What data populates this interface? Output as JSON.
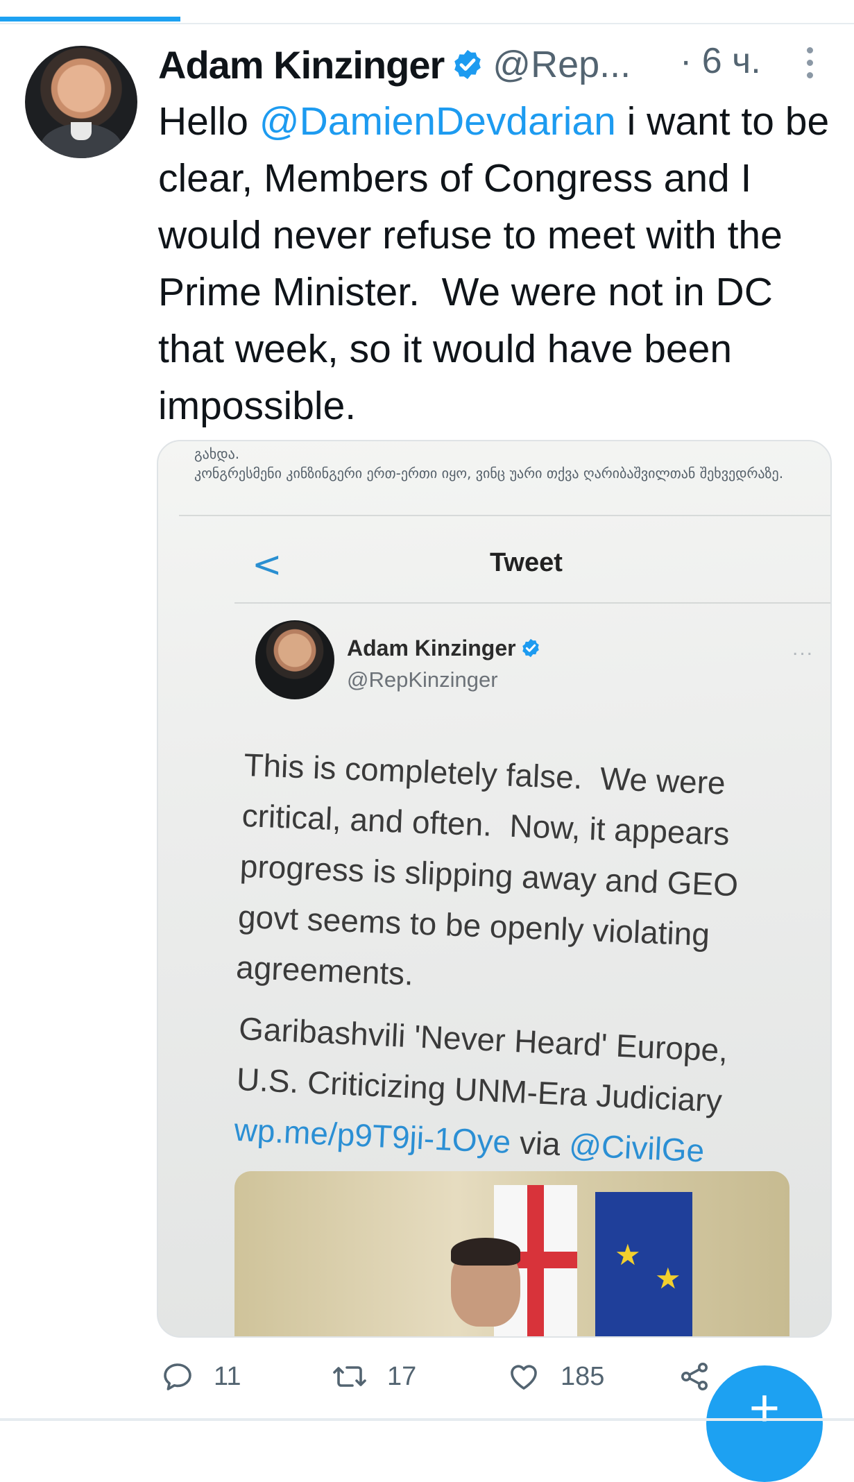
{
  "tweet": {
    "author_name": "Adam Kinzinger",
    "handle": "@Rep...",
    "time": "· 6 ч.",
    "text_before": "Hello ",
    "mention": "@DamienDevdarian",
    "text_after": " i want to be clear, Members of Congress and I would never refuse to meet with the Prime Minister.  We were not in DC that week, so it would have been impossible."
  },
  "media": {
    "georgian_text": "გახდა.\nკონგრესმენი კინზინგერი ერთ-ერთი იყო, ვინც უარი თქვა ღარიბაშვილთან შეხვედრაზე.",
    "inner_back": "<",
    "inner_title": "Tweet",
    "inner_author": "Adam Kinzinger",
    "inner_handle": "@RepKinzinger",
    "inner_more": "...",
    "inner_text": "This is completely false.  We were critical, and often.  Now, it appears progress is slipping away and GEO govt seems to be openly violating agreements.",
    "inner_headline": "Garibashvili 'Never Heard' Europe, U.S. Criticizing UNM-Era Judiciary",
    "inner_link": "wp.me/p9T9ji-1Oye",
    "inner_via": " via ",
    "inner_via_handle": "@CivilGe"
  },
  "actions": {
    "reply_count": "11",
    "retweet_count": "17",
    "like_count": "185"
  },
  "fab": {
    "label": "+"
  },
  "colors": {
    "accent": "#1da1f2",
    "link": "#1d9bf0",
    "secondary_text": "#536471"
  },
  "icons": [
    "verified-badge-icon",
    "more-vertical-icon",
    "back-chevron-icon",
    "reply-icon",
    "retweet-icon",
    "like-icon",
    "share-icon",
    "plus-icon"
  ]
}
